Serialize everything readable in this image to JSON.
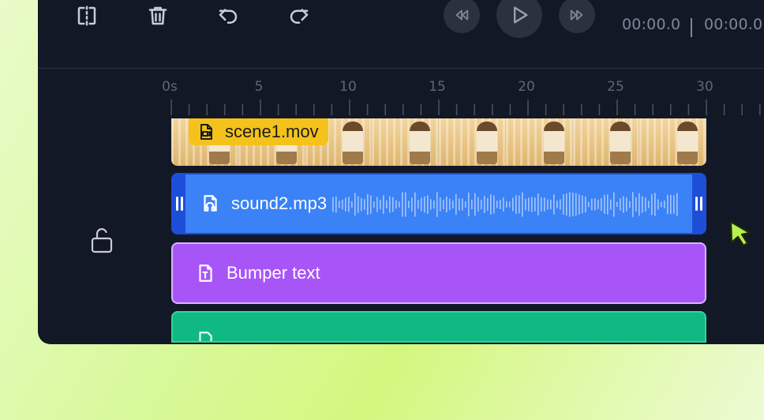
{
  "toolbar": {
    "split_label": "Split",
    "delete_label": "Delete",
    "undo_label": "Undo",
    "redo_label": "Redo"
  },
  "playback": {
    "rewind_icon": "rewind-icon",
    "play_icon": "play-icon",
    "forward_icon": "fast-forward-icon",
    "current_time": "00:00.0",
    "separator": "|",
    "total_time": "00:00.0"
  },
  "ruler": {
    "labels": [
      "0s",
      "5",
      "10",
      "15",
      "20",
      "25",
      "30"
    ]
  },
  "tracks": {
    "video": {
      "name": "scene1.mov",
      "icon": "video-file-icon",
      "color": "#f4c21b"
    },
    "audio": {
      "name": "sound2.mp3",
      "icon": "audio-file-icon",
      "color": "#3b82f6"
    },
    "text": {
      "name": "Bumper text",
      "icon": "text-file-icon",
      "color": "#a855f7"
    },
    "extra": {
      "icon": "text-file-icon",
      "color": "#10b981"
    }
  },
  "lock": {
    "icon": "unlock-icon",
    "state": "unlocked"
  },
  "colors": {
    "panel": "#131826",
    "accent_blue": "#1d4ed8",
    "cursor": "#b6f04f"
  }
}
